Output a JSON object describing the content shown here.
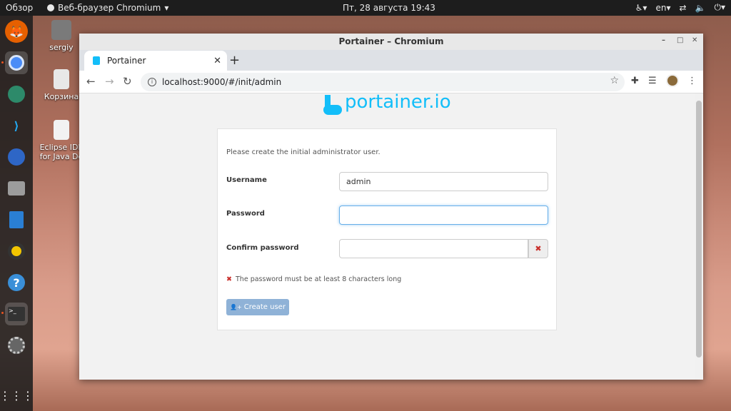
{
  "topbar": {
    "overview": "Обзор",
    "app_name": "Веб-браузер Chromium",
    "clock": "Пт, 28 августа  19:43",
    "lang": "en",
    "icons": [
      "accessibility-icon",
      "network-icon",
      "volume-icon",
      "power-icon"
    ]
  },
  "dock": {
    "items": [
      "firefox-icon",
      "chromium-icon",
      "remmina-icon",
      "vscode-icon",
      "thunderbird-icon",
      "files-icon",
      "writer-icon",
      "rhythmbox-icon",
      "help-icon",
      "terminal-icon",
      "settings-icon",
      "apps-grid-icon"
    ]
  },
  "desktop": {
    "icons": [
      {
        "label": "sergiy"
      },
      {
        "label": "Корзина"
      },
      {
        "label": "Eclipse IDE for Java De"
      }
    ]
  },
  "window": {
    "title": "Portainer – Chromium",
    "minimize": "–",
    "maximize": "□",
    "close": "✕"
  },
  "tab": {
    "label": "Portainer",
    "close": "✕",
    "new_tab": "+"
  },
  "address": {
    "url": "localhost:9000/#/init/admin",
    "back": "←",
    "forward": "→",
    "reload": "↻",
    "star": "☆",
    "menu": "⋮"
  },
  "page": {
    "logo_text": "portainer.io",
    "intro": "Please create the initial administrator user.",
    "username_label": "Username",
    "username_value": "admin",
    "password_label": "Password",
    "password_value": "",
    "confirm_label": "Confirm password",
    "confirm_value": "",
    "mismatch_icon": "✖",
    "warning_icon": "✖",
    "warning_text": "The password must be at least 8 characters long",
    "create_button": "Create user",
    "create_button_icon": "👤+"
  },
  "colors": {
    "brand": "#13bef9",
    "button_disabled": "#8fb2d7",
    "error": "#c9302c",
    "focus_border": "#66afe9"
  }
}
